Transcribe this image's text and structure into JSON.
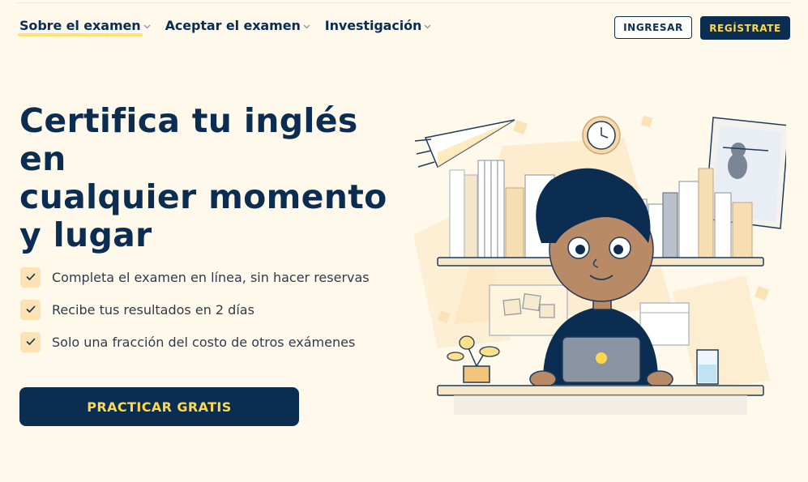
{
  "nav": {
    "items": [
      {
        "label": "Sobre el examen",
        "active": true
      },
      {
        "label": "Aceptar el examen",
        "active": false
      },
      {
        "label": "Investigación",
        "active": false
      }
    ],
    "login_label": "INGRESAR",
    "signup_label": "REGÍSTRATE"
  },
  "hero": {
    "title_line1": "Certifica tu inglés en",
    "title_line2": "cualquier momento",
    "title_line3": "y lugar",
    "features": [
      "Completa el examen en línea, sin hacer reservas",
      "Recibe tus resultados en 2 días",
      "Solo una fracción del costo de otros exámenes"
    ],
    "cta_label": "PRACTICAR GRATIS"
  },
  "icons": {
    "nav_dropdown": "chevron-down-icon",
    "feature_check": "check-icon"
  },
  "colors": {
    "background": "#fff9ec",
    "brand_navy": "#0b2d52",
    "accent_yellow": "#ffd84a",
    "check_bg": "#fde2b4"
  }
}
